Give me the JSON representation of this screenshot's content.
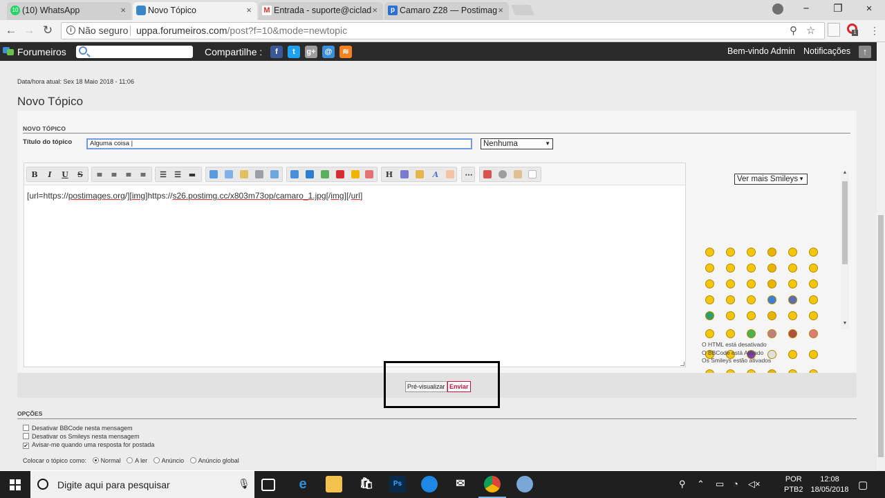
{
  "browser": {
    "tabs": [
      {
        "label": "(10) WhatsApp",
        "badge": "10"
      },
      {
        "label": "Novo Tópico"
      },
      {
        "label": "Entrada - suporte@ciclad"
      },
      {
        "label": "Camaro Z28 — Postimag"
      }
    ],
    "address": {
      "security": "Não seguro",
      "url_host": "uppa.forumeiros.com",
      "url_path": "/post?f=10&mode=newtopic"
    },
    "close_glyph": "×",
    "window_controls": [
      "−",
      "❐",
      "×"
    ]
  },
  "forumbar": {
    "brand": "Forumeiros",
    "share_label": "Compartilhe :",
    "welcome": "Bem-vindo Admin",
    "notifications": "Notificações",
    "social": [
      {
        "name": "facebook-icon",
        "glyph": "f",
        "color": "#3b5998"
      },
      {
        "name": "twitter-icon",
        "glyph": "t",
        "color": "#1da1f2"
      },
      {
        "name": "googleplus-icon",
        "glyph": "g+",
        "color": "#9e9e9e"
      },
      {
        "name": "email-icon",
        "glyph": "@",
        "color": "#3a8fd8"
      },
      {
        "name": "rss-icon",
        "glyph": "≋",
        "color": "#f58220"
      }
    ]
  },
  "page": {
    "datetime": "Data/hora atual: Sex 18 Maio 2018 - 11:06",
    "title": "Novo Tópico",
    "section_head": "NOVO TÓPICO",
    "title_label": "Título do tópico",
    "title_value": "Alguma coisa |",
    "topic_type": "Nenhuma",
    "editor_text": {
      "p1": "[url=https://",
      "u1": "postimages.org",
      "p2": "/][",
      "u2": "img",
      "p3": "]https://",
      "u3": "s26.postimg.cc/x803m73op/camaro_1.jpg",
      "p4": "[/",
      "u4": "img",
      "p5": "][/",
      "u5": "url",
      "p6": "]"
    },
    "smileys_select": "Ver mais Smileys",
    "notes": [
      "O HTML está desativado",
      "O BBCode está Ativado",
      "Os Smileys estão ativados"
    ],
    "buttons": {
      "preview": "Pré-visualizar",
      "submit": "Enviar"
    },
    "options_head": "OPÇÕES",
    "options": [
      {
        "label": "Desativar BBCode nesta mensagem",
        "checked": false
      },
      {
        "label": "Desativar os Smileys nesta mensagem",
        "checked": false
      },
      {
        "label": "Avisar-me quando uma resposta for postada",
        "checked": true
      }
    ],
    "post_as_label": "Colocar o tópico como:",
    "post_as": [
      {
        "label": "Normal",
        "selected": true
      },
      {
        "label": "A ler",
        "selected": false
      },
      {
        "label": "Anúncio",
        "selected": false
      },
      {
        "label": "Anúncio global",
        "selected": false
      }
    ]
  },
  "taskbar": {
    "search_placeholder": "Digite aqui para pesquisar",
    "lang": "POR",
    "layout": "PTB2",
    "time": "12:08",
    "date": "18/05/2018"
  }
}
